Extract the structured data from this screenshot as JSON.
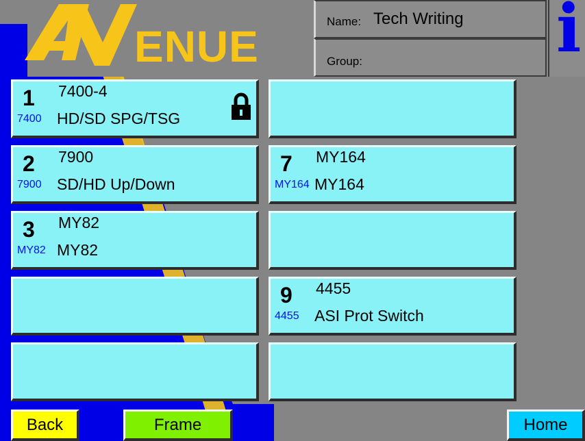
{
  "header": {
    "logo_text": "AVENUE",
    "name_label": "Name:",
    "name_value": "Tech Writing",
    "group_label": "Group:",
    "group_value": "",
    "info_icon": "info-icon"
  },
  "slots": {
    "slot1": {
      "number": "1",
      "model": "7400-4",
      "code": "7400",
      "description": "HD/SD SPG/TSG",
      "locked": true,
      "lock_icon": "padlock-icon"
    },
    "slot2": {
      "number": "2",
      "model": "7900",
      "code": "7900",
      "description": "SD/HD Up/Down"
    },
    "slot3": {
      "number": "3",
      "model": "MY82",
      "code": "MY82",
      "description": "MY82"
    },
    "slot7": {
      "number": "7",
      "model": "MY164",
      "code": "MY164",
      "description": "MY164"
    },
    "slot9": {
      "number": "9",
      "model": "4455",
      "code": "4455",
      "description": "ASI Prot Switch"
    }
  },
  "footer": {
    "back_label": "Back",
    "frame_label": "Frame",
    "home_label": "Home"
  },
  "colors": {
    "tile": "#88f2f6",
    "background": "#858585",
    "logo_yellow": "#f7c51a",
    "logo_blue": "#0000e6",
    "back_button": "#ffff00",
    "frame_button": "#7ff000",
    "home_button": "#00ccff"
  }
}
